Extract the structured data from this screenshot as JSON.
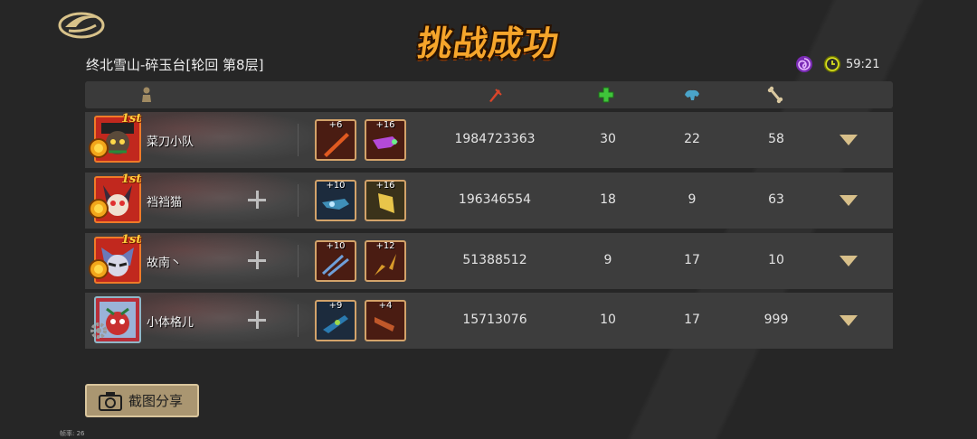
{
  "title": "挑战成功",
  "stage": "终北雪山-碎玉台[轮回 第8层]",
  "timer": "59:21",
  "header_icons": [
    "player-icon",
    "damage-icon",
    "heal-icon",
    "tank-icon",
    "bone-icon"
  ],
  "colors": {
    "accent": "#f6a52b",
    "row_bg": "#3d3d3d",
    "slot_border": "#d3a36a"
  },
  "players": [
    {
      "name": "菜刀小队",
      "rank": "1st",
      "weapons": [
        "+6",
        "+16"
      ],
      "damage": "1984723363",
      "heal": "30",
      "tank": "22",
      "bone": "58"
    },
    {
      "name": "裆裆猫",
      "rank": "1st",
      "weapons": [
        "+10",
        "+16"
      ],
      "damage": "196346554",
      "heal": "18",
      "tank": "9",
      "bone": "63"
    },
    {
      "name": "故南丶",
      "rank": "1st",
      "weapons": [
        "+10",
        "+12"
      ],
      "damage": "51388512",
      "heal": "9",
      "tank": "17",
      "bone": "10"
    },
    {
      "name": "小体格儿",
      "rank": "",
      "weapons": [
        "+9",
        "+4"
      ],
      "damage": "15713076",
      "heal": "10",
      "tank": "17",
      "bone": "999"
    }
  ],
  "share_label": "截图分享",
  "fps": "帧率: 26"
}
